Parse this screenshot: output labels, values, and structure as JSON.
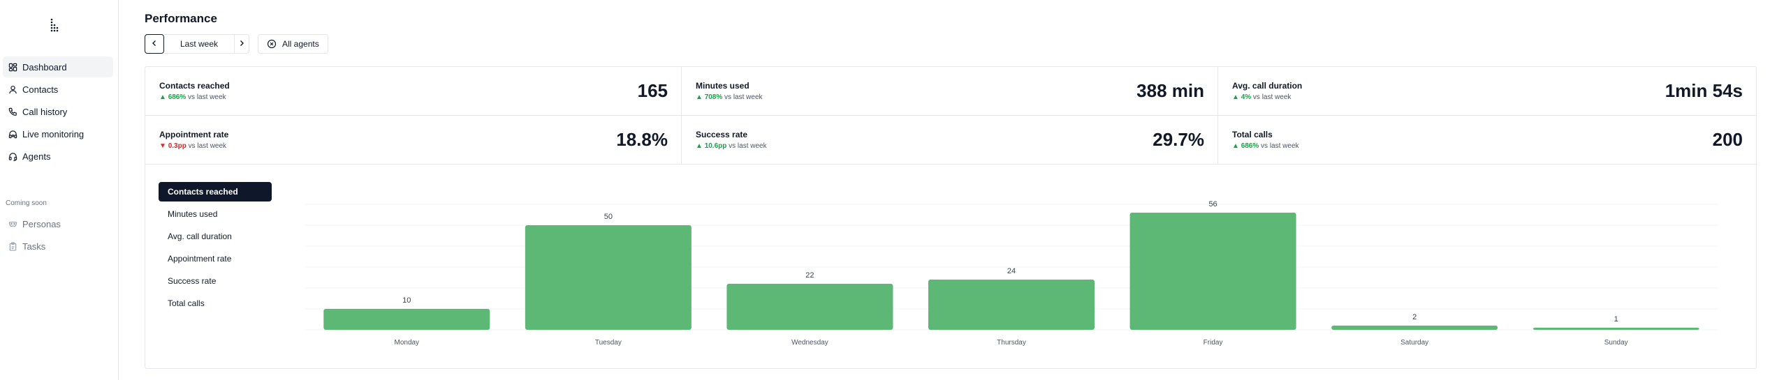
{
  "sidebar": {
    "logo_icon": "braille-dots-logo",
    "items": [
      {
        "label": "Dashboard",
        "icon": "dashboard-icon",
        "active": true
      },
      {
        "label": "Contacts",
        "icon": "user-icon",
        "active": false
      },
      {
        "label": "Call history",
        "icon": "phone-icon",
        "active": false
      },
      {
        "label": "Live monitoring",
        "icon": "headset-live-icon",
        "active": false
      },
      {
        "label": "Agents",
        "icon": "headset-icon",
        "active": false
      }
    ],
    "coming_soon_label": "Coming soon",
    "coming_soon_items": [
      {
        "label": "Personas",
        "icon": "mask-icon"
      },
      {
        "label": "Tasks",
        "icon": "clipboard-icon"
      }
    ]
  },
  "header": {
    "title": "Performance",
    "period_label": "Last week",
    "agents_filter_label": "All agents"
  },
  "stats": [
    {
      "label": "Contacts reached",
      "value": "165",
      "delta": "686%",
      "direction": "up",
      "compare": "vs last week"
    },
    {
      "label": "Minutes used",
      "value": "388 min",
      "delta": "708%",
      "direction": "up",
      "compare": "vs last week"
    },
    {
      "label": "Avg. call duration",
      "value": "1min 54s",
      "delta": "4%",
      "direction": "up",
      "compare": "vs last week"
    },
    {
      "label": "Appointment rate",
      "value": "18.8%",
      "delta": "0.3pp",
      "direction": "down",
      "compare": "vs last week"
    },
    {
      "label": "Success rate",
      "value": "29.7%",
      "delta": "10.6pp",
      "direction": "up",
      "compare": "vs last week"
    },
    {
      "label": "Total calls",
      "value": "200",
      "delta": "686%",
      "direction": "up",
      "compare": "vs last week"
    }
  ],
  "metrics": [
    {
      "label": "Contacts reached",
      "active": true
    },
    {
      "label": "Minutes used",
      "active": false
    },
    {
      "label": "Avg. call duration",
      "active": false
    },
    {
      "label": "Appointment rate",
      "active": false
    },
    {
      "label": "Success rate",
      "active": false
    },
    {
      "label": "Total calls",
      "active": false
    }
  ],
  "colors": {
    "bar": "#5cb874",
    "up": "#16a34a",
    "down": "#dc2626",
    "active_bg": "#0f172a"
  },
  "chart_data": {
    "type": "bar",
    "categories": [
      "Monday",
      "Tuesday",
      "Wednesday",
      "Thursday",
      "Friday",
      "Saturday",
      "Sunday"
    ],
    "values": [
      10,
      50,
      22,
      24,
      56,
      2,
      1
    ],
    "ylim": [
      0,
      60
    ],
    "grid": true,
    "data_labels": true
  }
}
